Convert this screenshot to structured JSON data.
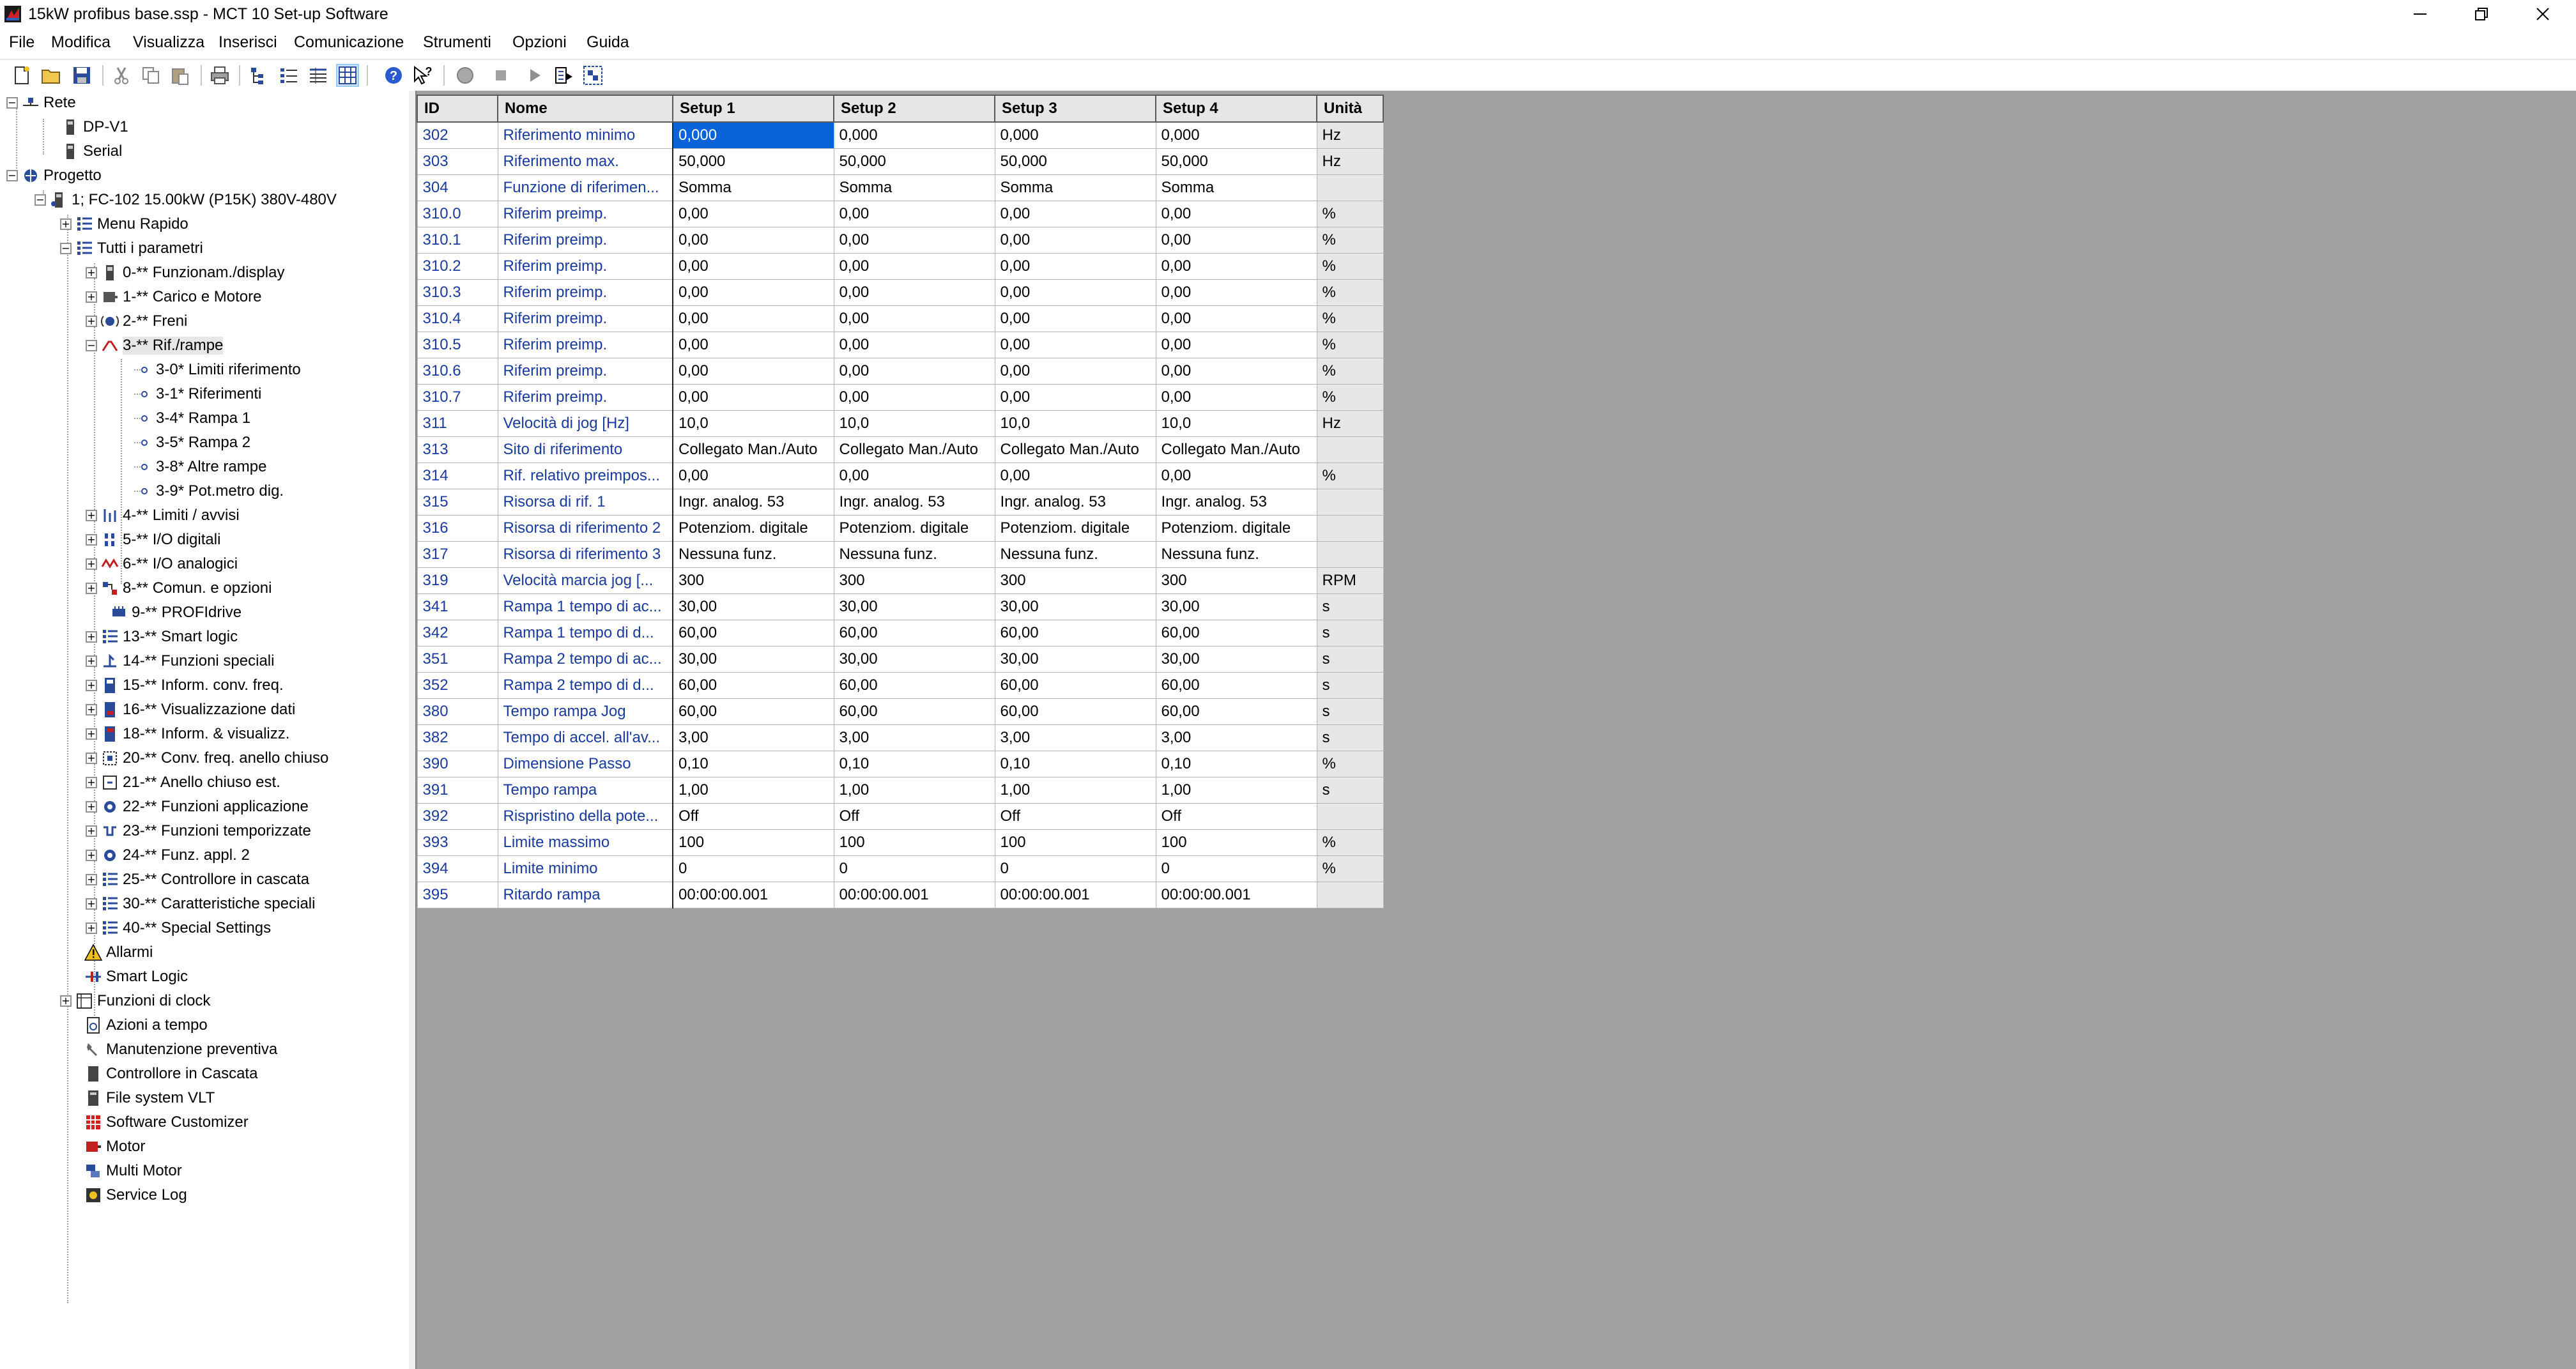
{
  "window": {
    "title": "15kW profibus base.ssp - MCT 10 Set-up Software",
    "app_icon": "mct10-app-icon",
    "controls": [
      "minimize-icon",
      "restore-icon",
      "close-icon"
    ]
  },
  "menu": [
    "File",
    "Modifica",
    "Visualizza",
    "Inserisci",
    "Comunicazione",
    "Strumenti",
    "Opzioni",
    "Guida"
  ],
  "toolbar": {
    "icons": [
      "new-icon",
      "open-icon",
      "save-icon",
      "cut-icon",
      "copy-icon",
      "paste-icon",
      "print-icon",
      "tree-view-icon",
      "list-view-icon",
      "details-view-icon",
      "grid-view-icon",
      "help-icon",
      "context-help-icon",
      "record-icon",
      "stop-icon",
      "play-icon",
      "read-from-drive-icon",
      "write-to-drive-icon"
    ]
  },
  "tree": {
    "rete": "Rete",
    "dp_v1": "DP-V1",
    "serial": "Serial",
    "progetto": "Progetto",
    "drive": "1; FC-102 15.00kW (P15K) 380V-480V",
    "menu_rapido": "Menu Rapido",
    "tutti_parametri": "Tutti i parametri",
    "groups": [
      "0-** Funzionam./display",
      "1-** Carico e Motore",
      "2-** Freni",
      "3-** Rif./rampe",
      "3-0* Limiti riferimento",
      "3-1* Riferimenti",
      "3-4* Rampa 1",
      "3-5* Rampa 2",
      "3-8* Altre rampe",
      "3-9* Pot.metro dig.",
      "4-** Limiti / avvisi",
      "5-** I/O digitali",
      "6-** I/O analogici",
      "8-** Comun. e opzioni",
      "9-** PROFIdrive",
      "13-** Smart logic",
      "14-** Funzioni speciali",
      "15-** Inform. conv. freq.",
      "16-** Visualizzazione dati",
      "18-** Inform. & visualizz.",
      "20-** Conv. freq. anello chiuso",
      "21-** Anello chiuso est.",
      "22-** Funzioni applicazione",
      "23-** Funzioni temporizzate",
      "24-** Funz. appl. 2",
      "25-** Controllore in cascata",
      "30-** Caratteristiche speciali",
      "40-** Special Settings"
    ],
    "tools": [
      "Allarmi",
      "Smart Logic",
      "Funzioni di clock",
      "Azioni a tempo",
      "Manutenzione preventiva",
      "Controllore in Cascata",
      "File system VLT",
      "Software Customizer",
      "Motor",
      "Multi Motor",
      "Service Log"
    ]
  },
  "table": {
    "headers": [
      "ID",
      "Nome",
      "Setup 1",
      "Setup 2",
      "Setup 3",
      "Setup 4",
      "Unità"
    ],
    "rows": [
      [
        "302",
        "Riferimento minimo",
        "0,000",
        "0,000",
        "0,000",
        "0,000",
        "Hz"
      ],
      [
        "303",
        "Riferimento max.",
        "50,000",
        "50,000",
        "50,000",
        "50,000",
        "Hz"
      ],
      [
        "304",
        "Funzione di riferimen...",
        "Somma",
        "Somma",
        "Somma",
        "Somma",
        ""
      ],
      [
        "310.0",
        "Riferim preimp.",
        "0,00",
        "0,00",
        "0,00",
        "0,00",
        "%"
      ],
      [
        "310.1",
        "Riferim preimp.",
        "0,00",
        "0,00",
        "0,00",
        "0,00",
        "%"
      ],
      [
        "310.2",
        "Riferim preimp.",
        "0,00",
        "0,00",
        "0,00",
        "0,00",
        "%"
      ],
      [
        "310.3",
        "Riferim preimp.",
        "0,00",
        "0,00",
        "0,00",
        "0,00",
        "%"
      ],
      [
        "310.4",
        "Riferim preimp.",
        "0,00",
        "0,00",
        "0,00",
        "0,00",
        "%"
      ],
      [
        "310.5",
        "Riferim preimp.",
        "0,00",
        "0,00",
        "0,00",
        "0,00",
        "%"
      ],
      [
        "310.6",
        "Riferim preimp.",
        "0,00",
        "0,00",
        "0,00",
        "0,00",
        "%"
      ],
      [
        "310.7",
        "Riferim preimp.",
        "0,00",
        "0,00",
        "0,00",
        "0,00",
        "%"
      ],
      [
        "311",
        "Velocità di jog [Hz]",
        "10,0",
        "10,0",
        "10,0",
        "10,0",
        "Hz"
      ],
      [
        "313",
        "Sito di riferimento",
        "Collegato Man./Auto",
        "Collegato Man./Auto",
        "Collegato Man./Auto",
        "Collegato Man./Auto",
        ""
      ],
      [
        "314",
        "Rif. relativo preimpos...",
        "0,00",
        "0,00",
        "0,00",
        "0,00",
        "%"
      ],
      [
        "315",
        "Risorsa di rif. 1",
        "Ingr. analog. 53",
        "Ingr. analog. 53",
        "Ingr. analog. 53",
        "Ingr. analog. 53",
        ""
      ],
      [
        "316",
        "Risorsa di riferimento 2",
        "Potenziom. digitale",
        "Potenziom. digitale",
        "Potenziom. digitale",
        "Potenziom. digitale",
        ""
      ],
      [
        "317",
        "Risorsa di riferimento 3",
        "Nessuna funz.",
        "Nessuna funz.",
        "Nessuna funz.",
        "Nessuna funz.",
        ""
      ],
      [
        "319",
        "Velocità marcia jog [...",
        "300",
        "300",
        "300",
        "300",
        "RPM"
      ],
      [
        "341",
        "Rampa 1 tempo di ac...",
        "30,00",
        "30,00",
        "30,00",
        "30,00",
        "s"
      ],
      [
        "342",
        "Rampa 1 tempo di d...",
        "60,00",
        "60,00",
        "60,00",
        "60,00",
        "s"
      ],
      [
        "351",
        "Rampa 2 tempo di ac...",
        "30,00",
        "30,00",
        "30,00",
        "30,00",
        "s"
      ],
      [
        "352",
        "Rampa 2 tempo di d...",
        "60,00",
        "60,00",
        "60,00",
        "60,00",
        "s"
      ],
      [
        "380",
        "Tempo rampa Jog",
        "60,00",
        "60,00",
        "60,00",
        "60,00",
        "s"
      ],
      [
        "382",
        "Tempo di accel. all'av...",
        "3,00",
        "3,00",
        "3,00",
        "3,00",
        "s"
      ],
      [
        "390",
        "Dimensione Passo",
        "0,10",
        "0,10",
        "0,10",
        "0,10",
        "%"
      ],
      [
        "391",
        "Tempo rampa",
        "1,00",
        "1,00",
        "1,00",
        "1,00",
        "s"
      ],
      [
        "392",
        "Rispristino della pote...",
        "Off",
        "Off",
        "Off",
        "Off",
        ""
      ],
      [
        "393",
        "Limite massimo",
        "100",
        "100",
        "100",
        "100",
        "%"
      ],
      [
        "394",
        "Limite minimo",
        "0",
        "0",
        "0",
        "0",
        "%"
      ],
      [
        "395",
        "Ritardo rampa",
        "00:00:00.001",
        "00:00:00.001",
        "00:00:00.001",
        "00:00:00.001",
        ""
      ]
    ],
    "selected_cell": "0,000"
  },
  "colors": {
    "link_text": "#1a3a9c",
    "selection": "#0a64d8",
    "grid_background": "#a0a0a0",
    "header_background": "#e6e6e6"
  }
}
